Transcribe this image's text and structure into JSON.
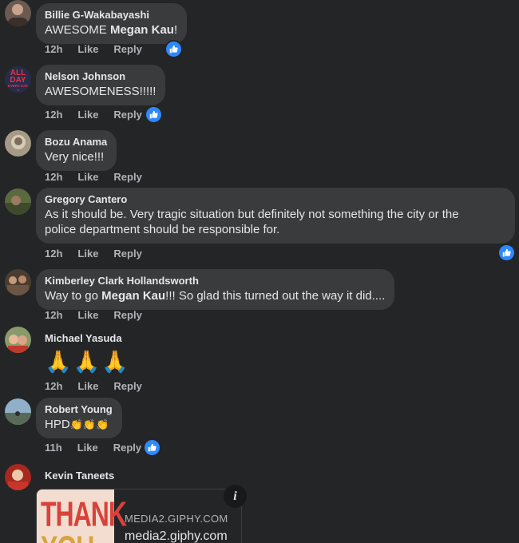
{
  "comments": [
    {
      "name": "Billie G-Wakabayashi",
      "text_before": "AWESOME ",
      "mention": "Megan Kau",
      "text_after": "!",
      "time": "12h",
      "like": "Like",
      "reply": "Reply",
      "liked": true
    },
    {
      "name": "Nelson Johnson",
      "text": "AWESOMENESS!!!!!",
      "time": "12h",
      "like": "Like",
      "reply": "Reply",
      "liked": true,
      "avatar_text": [
        "ALL",
        "DAY",
        "EVERY DAY"
      ]
    },
    {
      "name": "Bozu Anama",
      "text": "Very nice!!!",
      "time": "12h",
      "like": "Like",
      "reply": "Reply",
      "liked": false
    },
    {
      "name": "Gregory Cantero",
      "text_line1": "As it should be. Very tragic situation but definitely not something the city or the",
      "text_line2": "police department should be responsible for.",
      "time": "12h",
      "like": "Like",
      "reply": "Reply",
      "liked": true
    },
    {
      "name": "Kimberley Clark Hollandsworth",
      "text_before": "Way to go ",
      "mention": "Megan Kau",
      "text_after": "!!! So glad this turned out the way it did....",
      "time": "12h",
      "like": "Like",
      "reply": "Reply",
      "liked": false
    },
    {
      "name": "Michael Yasuda",
      "emoji": "🙏🙏🙏",
      "time": "12h",
      "like": "Like",
      "reply": "Reply",
      "liked": false
    },
    {
      "name": "Robert Young",
      "text": "HPD",
      "emoji": "👏👏👏",
      "time": "11h",
      "like": "Like",
      "reply": "Reply",
      "liked": true
    },
    {
      "name": "Kevin Taneets",
      "gif": {
        "thumb_text": "THANK",
        "thumb_text2": "YOU",
        "domain": "MEDIA2.GIPHY.COM",
        "url": "media2.giphy.com"
      }
    }
  ],
  "colors": {
    "background": "#242526",
    "bubble": "#3a3b3c",
    "accent": "#2e89ff",
    "muted_text": "#b0b3b8"
  }
}
